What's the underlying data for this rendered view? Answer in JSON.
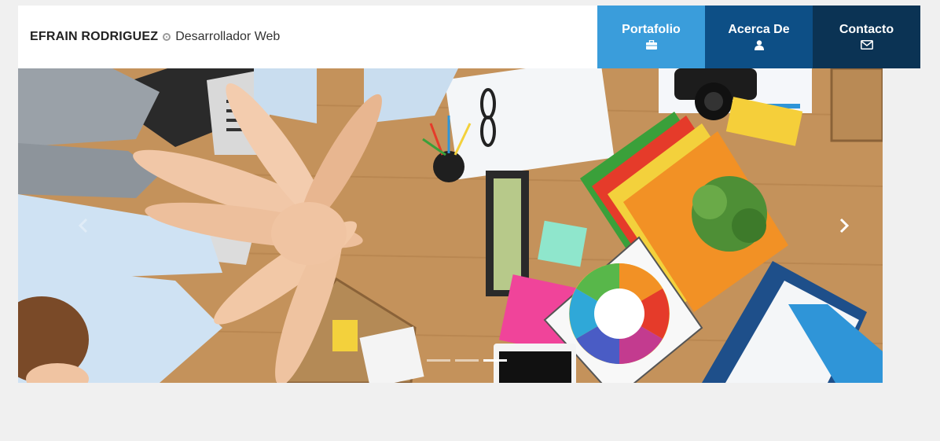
{
  "header": {
    "brand_name": "EFRAIN RODRIGUEZ",
    "brand_role": "Desarrollador Web"
  },
  "nav": {
    "items": [
      {
        "label": "Portafolio",
        "icon": "briefcase-icon",
        "color": "#3a9ddb"
      },
      {
        "label": "Acerca De",
        "icon": "user-icon",
        "color": "#0d4f86"
      },
      {
        "label": "Contacto",
        "icon": "envelope-icon",
        "color": "#0b3354"
      }
    ]
  },
  "carousel": {
    "image": "hero-teamwork-photo",
    "indicators": 3,
    "active_index": 2
  }
}
